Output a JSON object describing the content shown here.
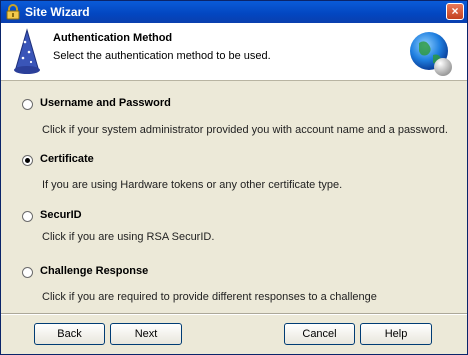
{
  "window": {
    "title": "Site Wizard",
    "close_label": "×"
  },
  "header": {
    "title": "Authentication Method",
    "subtitle": "Select the authentication method to be used."
  },
  "options": [
    {
      "label": "Username and Password",
      "description": "Click if your system administrator provided you with account name and a password.",
      "selected": false
    },
    {
      "label": "Certificate",
      "description": "If you are using Hardware tokens or any other certificate type.",
      "selected": true
    },
    {
      "label": "SecurID",
      "description": "Click if you are using RSA SecurID.",
      "selected": false
    },
    {
      "label": "Challenge Response",
      "description": "Click if you are required to provide different responses to a challenge",
      "selected": false
    }
  ],
  "buttons": {
    "back": "Back",
    "next": "Next",
    "cancel": "Cancel",
    "help": "Help"
  },
  "icons": {
    "title": "lock-icon",
    "wizard": "wizard-hat-icon",
    "globe": "globe-icon",
    "close": "close-icon"
  },
  "colors": {
    "titlebar": "#0a5bd8",
    "dialog_bg": "#ece9d8",
    "header_bg": "#ffffff",
    "button_border": "#003c74"
  }
}
